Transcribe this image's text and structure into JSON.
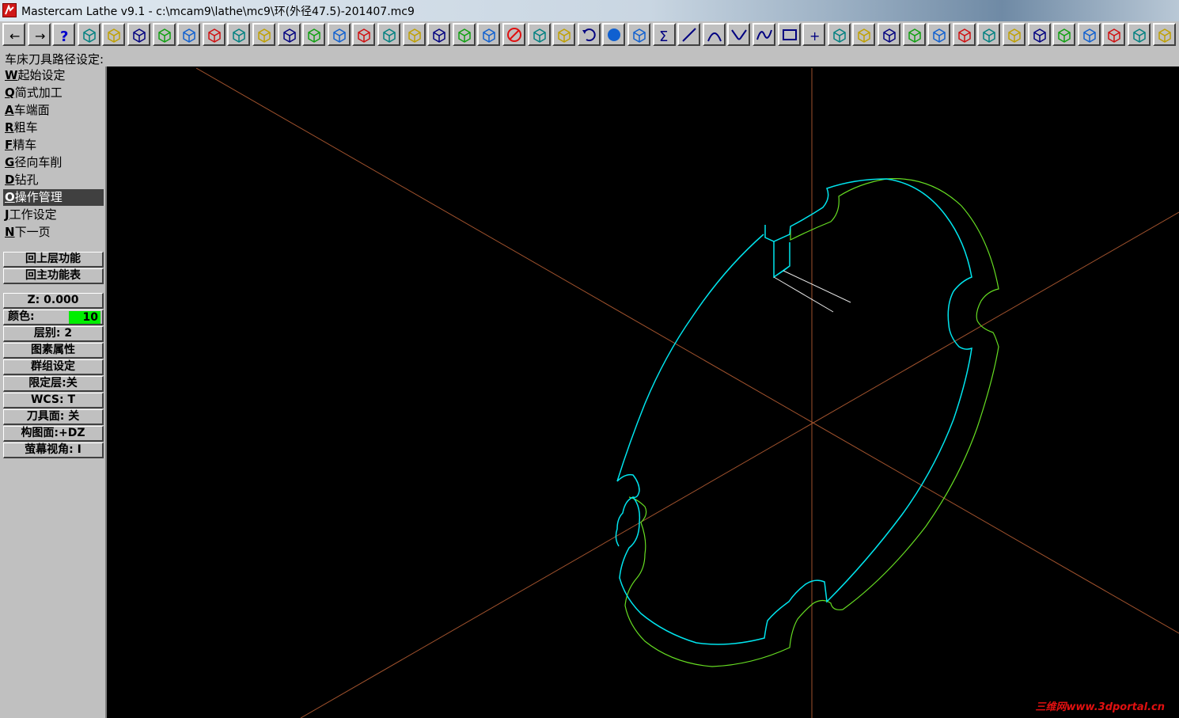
{
  "window": {
    "title": "Mastercam Lathe v9.1 - c:\\mcam9\\lathe\\mc9\\环(外径47.5)-201407.mc9"
  },
  "toolbar": {
    "buttons": [
      "back-arrow-icon",
      "forward-arrow-icon",
      "help-icon",
      "file-icon",
      "zoom-window-icon",
      "zoom-icon",
      "unzoom-icon",
      "zoom-fit-icon",
      "pan-icon",
      "select-icon",
      "rotate-icon",
      "view-front-icon",
      "view-top-icon",
      "view-side-icon",
      "view-iso-icon",
      "view-cube-icon",
      "view-cube-red-icon",
      "view-cube-shaded-icon",
      "view-3d-icon",
      "pencil-icon",
      "delete-icon",
      "translate-icon",
      "copy-icon",
      "undo-icon",
      "shade-icon",
      "group-icon",
      "sigma-icon",
      "line-icon",
      "arc-icon",
      "fillet-icon",
      "spline-icon",
      "rectangle-icon",
      "point-icon",
      "trim-icon",
      "trim2-icon",
      "break-icon",
      "extend-icon",
      "modify-line-icon",
      "divide-icon",
      "drill-icon",
      "toolpath-icon",
      "rough-icon",
      "finish-icon",
      "thread-icon",
      "groove-icon",
      "cutoff-icon",
      "face-icon"
    ]
  },
  "prompt": {
    "text": "车床刀具路径设定:"
  },
  "menu": {
    "items": [
      {
        "key": "W",
        "label": "起始设定"
      },
      {
        "key": "Q",
        "label": "简式加工"
      },
      {
        "key": "A",
        "label": "车端面"
      },
      {
        "key": "R",
        "label": "粗车"
      },
      {
        "key": "F",
        "label": "精车"
      },
      {
        "key": "G",
        "label": "径向车削"
      },
      {
        "key": "D",
        "label": "钻孔"
      },
      {
        "key": "O",
        "label": "操作管理"
      },
      {
        "key": "J",
        "label": "工作设定"
      },
      {
        "key": "N",
        "label": "下一页"
      }
    ],
    "selected_index": 7,
    "back_level": "回上层功能",
    "main_menu": "回主功能表"
  },
  "status": {
    "z": "Z:   0.000",
    "color_label": "颜色:",
    "color_value": "10",
    "color_swatch": "#00ee00",
    "level": "层别:  2",
    "attributes": "图素属性",
    "group": "群组设定",
    "limit_level": "限定层:关",
    "wcs": "WCS:    T",
    "tool_plane": "刀具面: 关",
    "construction_plane": "构图面:+DZ",
    "screen_view": "萤幕视角:  I"
  },
  "viewport": {
    "axis_color": "#a0522d",
    "profile_front_color": "#00e5ee",
    "profile_back_color": "#66dd22",
    "tool_line_color": "#e8e8e8"
  },
  "watermark": "三维网www.3dportal.cn"
}
